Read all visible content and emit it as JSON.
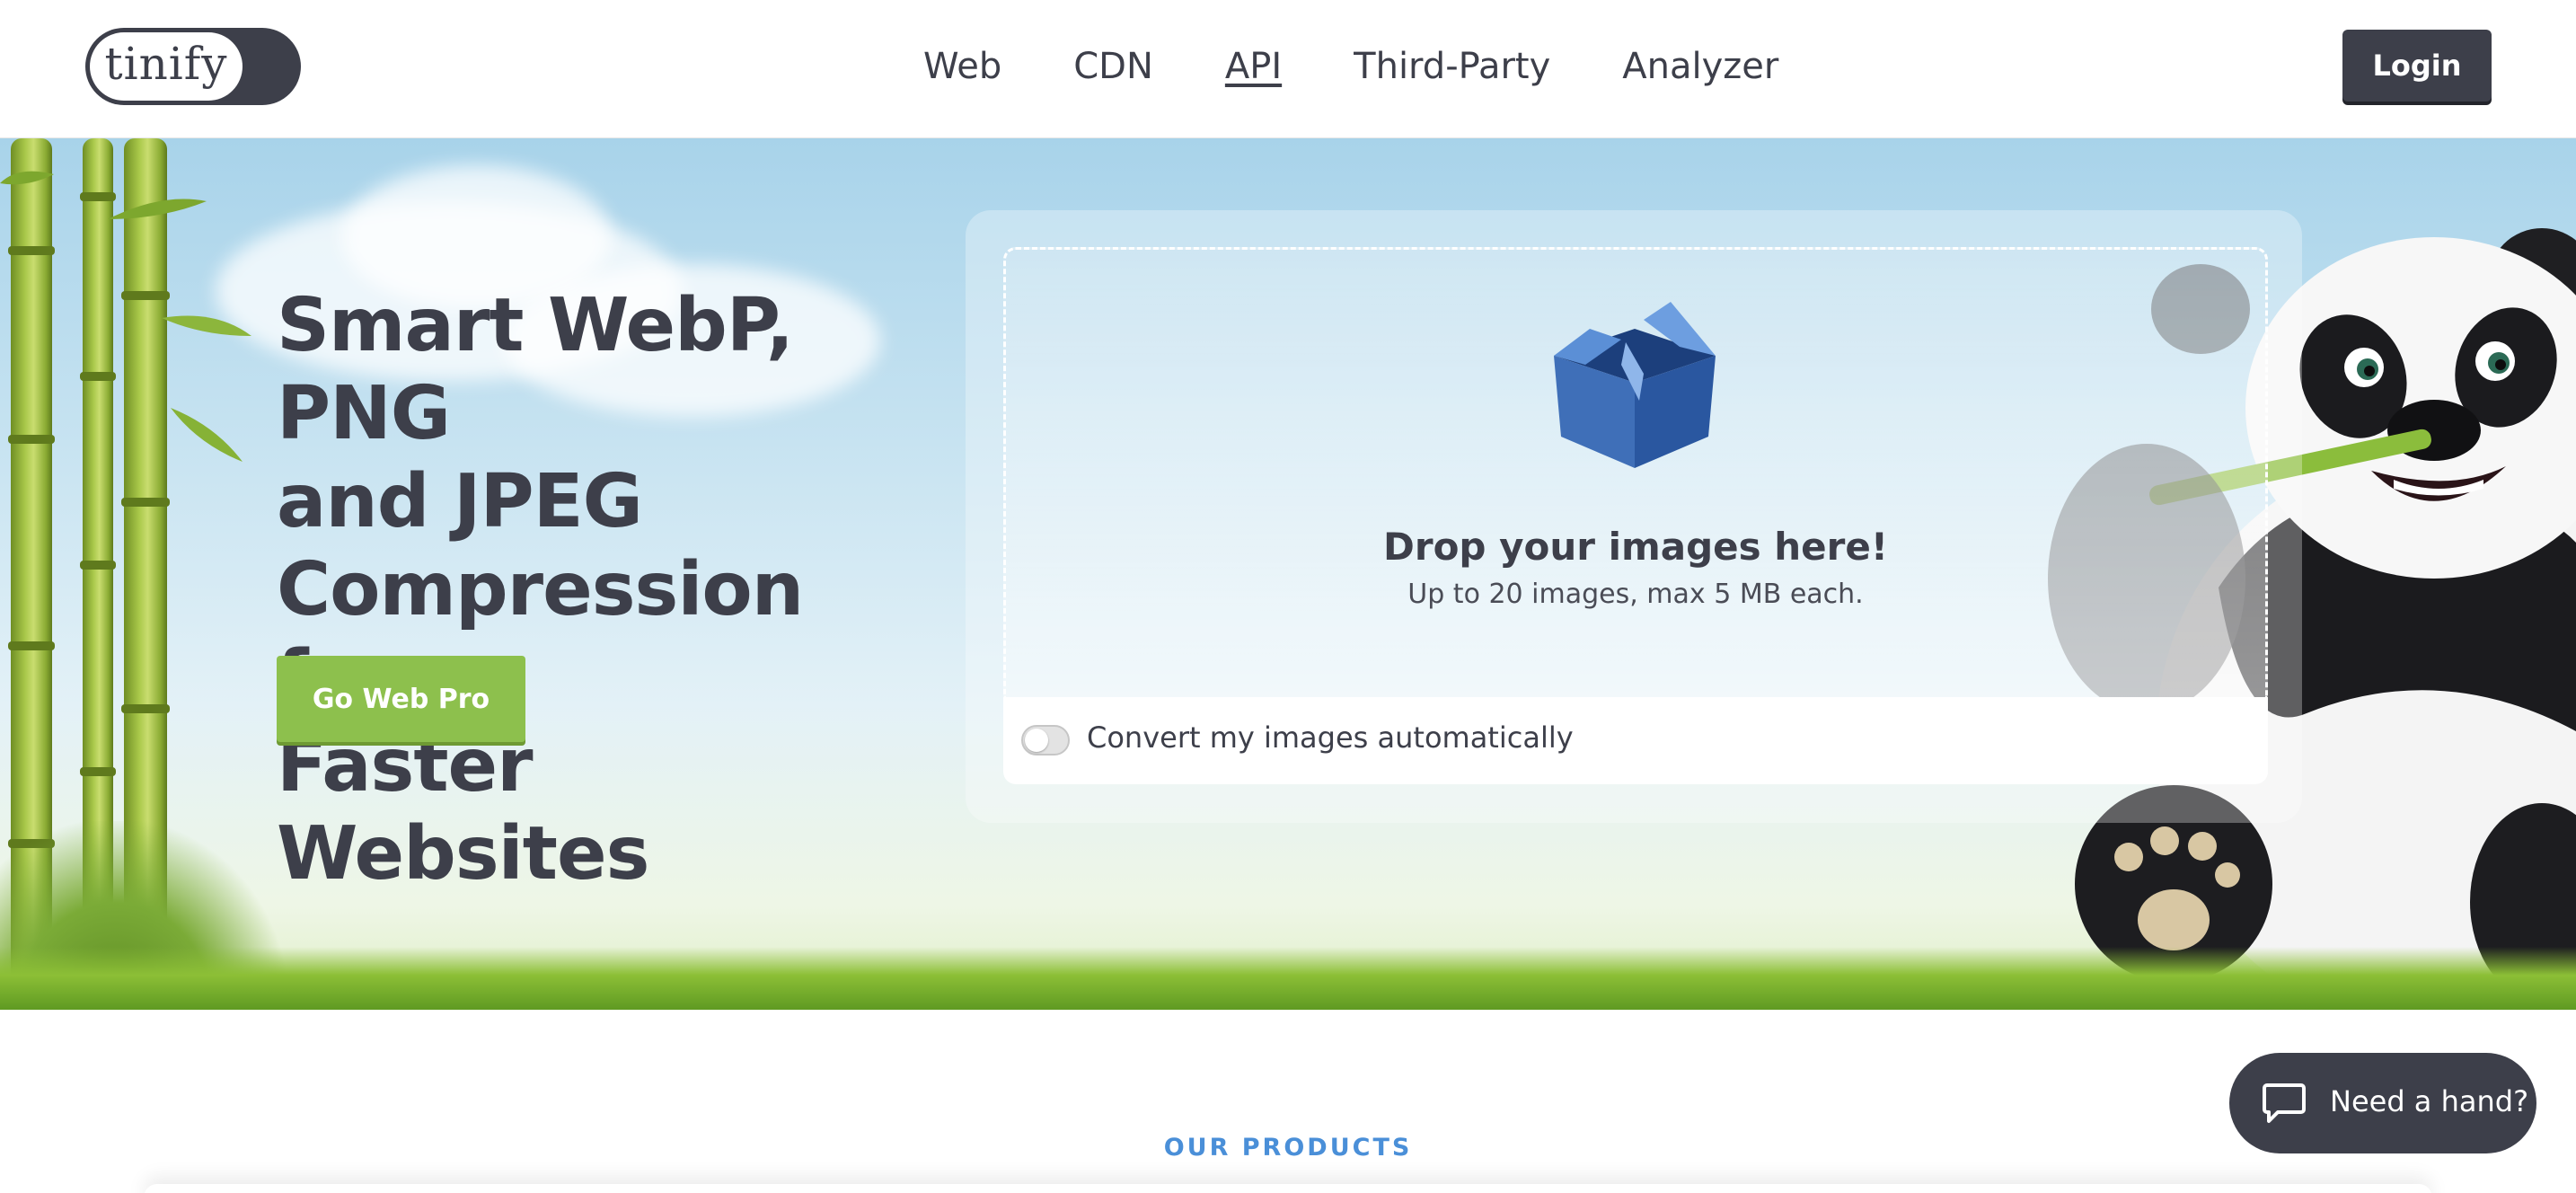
{
  "header": {
    "logo_text": "tinify",
    "nav": [
      {
        "label": "Web",
        "active": false
      },
      {
        "label": "CDN",
        "active": false
      },
      {
        "label": "API",
        "active": true
      },
      {
        "label": "Third-Party",
        "active": false
      },
      {
        "label": "Analyzer",
        "active": false
      }
    ],
    "login_label": "Login"
  },
  "hero": {
    "headline_lines": [
      "Smart WebP, PNG",
      "and JPEG",
      "Compression for",
      "Faster Websites"
    ],
    "cta_label": "Go Web Pro",
    "dropzone": {
      "title": "Drop your images here!",
      "subtitle": "Up to 20 images, max 5 MB each.",
      "convert_label": "Convert my images automatically",
      "convert_enabled": false
    }
  },
  "products_label": "OUR PRODUCTS",
  "help_widget": {
    "label": "Need a hand?"
  },
  "colors": {
    "dark": "#3d3f4a",
    "cta_green": "#8dc04d",
    "accent_blue": "#4a8fd8",
    "sky": "#a8d3ea"
  }
}
